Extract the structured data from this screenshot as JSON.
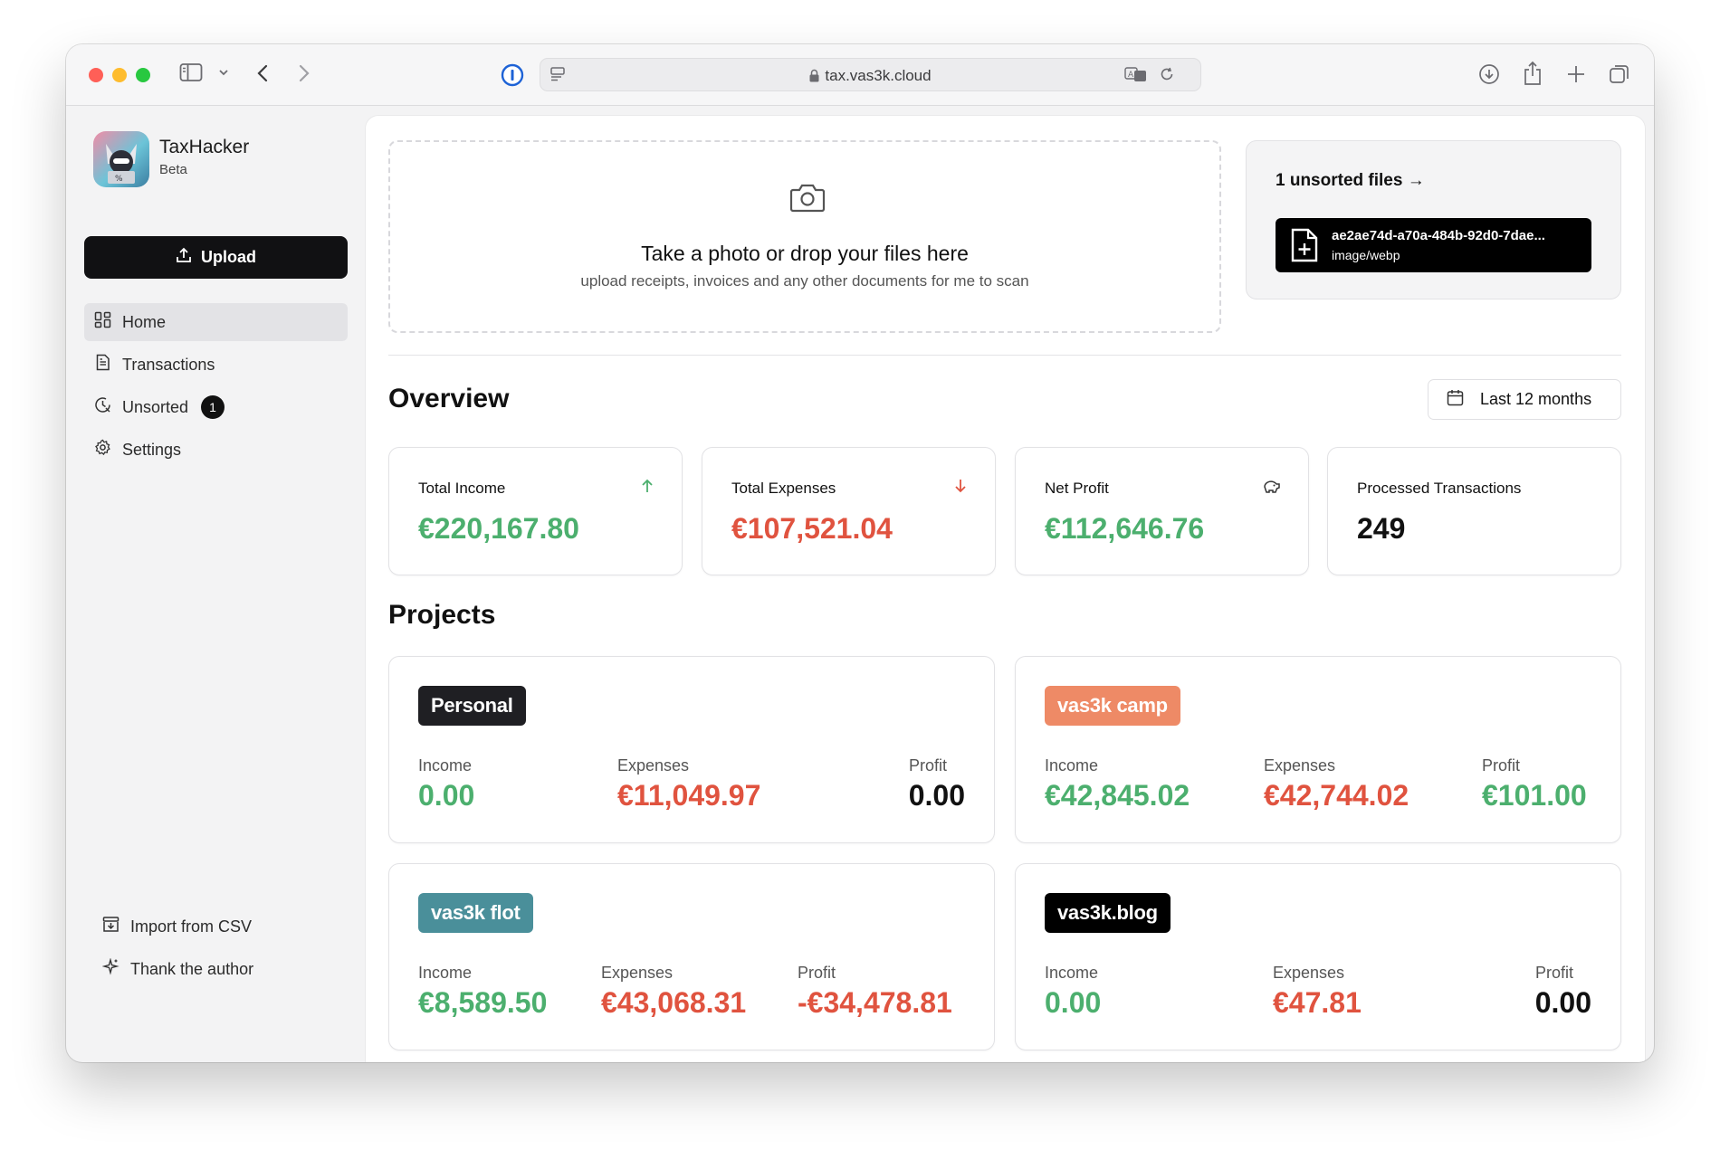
{
  "browser": {
    "url": "tax.vas3k.cloud"
  },
  "app": {
    "name": "TaxHacker",
    "subtitle": "Beta"
  },
  "sidebar": {
    "upload_label": "Upload",
    "items": [
      {
        "label": "Home",
        "icon": "grid-icon",
        "active": true
      },
      {
        "label": "Transactions",
        "icon": "document-icon",
        "active": false
      },
      {
        "label": "Unsorted",
        "icon": "clock-icon",
        "active": false,
        "badge": "1"
      },
      {
        "label": "Settings",
        "icon": "gear-icon",
        "active": false
      }
    ],
    "footer": [
      {
        "label": "Import from CSV",
        "icon": "import-icon"
      },
      {
        "label": "Thank the author",
        "icon": "sparkle-icon"
      }
    ]
  },
  "dropzone": {
    "title": "Take a photo or drop your files here",
    "subtitle": "upload receipts, invoices and any other documents for me to scan"
  },
  "unsorted": {
    "title": "1 unsorted files →",
    "file_name": "ae2ae74d-a70a-484b-92d0-7dae...",
    "file_type": "image/webp"
  },
  "overview": {
    "title": "Overview",
    "range_label": "Last 12 months",
    "stats": [
      {
        "label": "Total Income",
        "value": "€220,167.80",
        "tone": "green",
        "icon": "arrow-up-icon"
      },
      {
        "label": "Total Expenses",
        "value": "€107,521.04",
        "tone": "red",
        "icon": "arrow-down-icon"
      },
      {
        "label": "Net Profit",
        "value": "€112,646.76",
        "tone": "green",
        "icon": "piggy-bank-icon"
      },
      {
        "label": "Processed Transactions",
        "value": "249",
        "tone": "black",
        "icon": ""
      }
    ]
  },
  "projects": {
    "title": "Projects",
    "col_labels": {
      "income": "Income",
      "expenses": "Expenses",
      "profit": "Profit"
    },
    "items": [
      {
        "name": "Personal",
        "color": "#1f1f23",
        "income": "0.00",
        "expenses": "€11,049.97",
        "profit": "0.00"
      },
      {
        "name": "vas3k camp",
        "color": "#ee8a66",
        "income": "€42,845.02",
        "expenses": "€42,744.02",
        "profit": "€101.00"
      },
      {
        "name": "vas3k flot",
        "color": "#4a8f9a",
        "income": "€8,589.50",
        "expenses": "€43,068.31",
        "profit": "-€34,478.81"
      },
      {
        "name": "vas3k.blog",
        "color": "#000000",
        "income": "0.00",
        "expenses": "€47.81",
        "profit": "0.00"
      }
    ]
  },
  "colors": {
    "positive": "#4caf6e",
    "negative": "#e0533f",
    "accent": "#111113"
  }
}
